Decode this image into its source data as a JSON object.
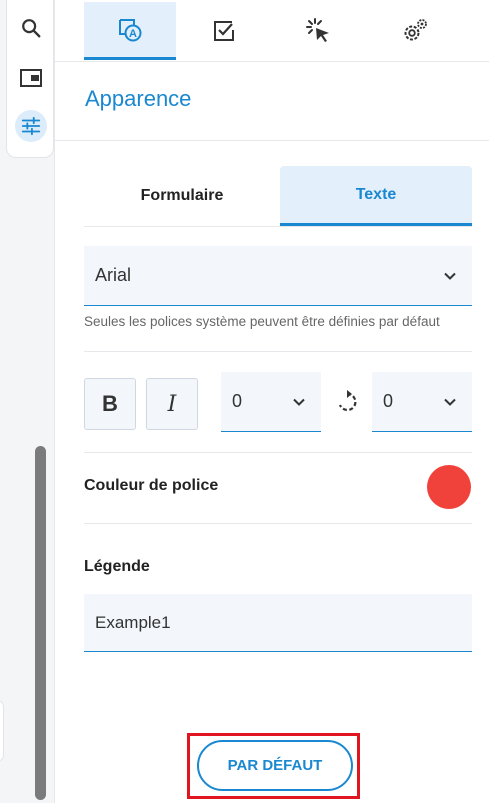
{
  "rail": {
    "icons": [
      "search-icon",
      "panel-icon",
      "sliders-icon"
    ],
    "active_index": 2
  },
  "top_tabs": {
    "icons": [
      "appearance-icon",
      "checkbox-icon",
      "click-icon",
      "settings-icon"
    ],
    "active_index": 0
  },
  "section": {
    "title": "Apparence"
  },
  "sub_tabs": {
    "items": [
      {
        "label": "Formulaire"
      },
      {
        "label": "Texte"
      }
    ],
    "active_index": 1
  },
  "font": {
    "value": "Arial",
    "hint": "Seules les polices système peuvent être définies par défaut"
  },
  "format": {
    "bold_label": "B",
    "italic_label": "I",
    "size_value": "0",
    "rotation_value": "0"
  },
  "color": {
    "label": "Couleur de police",
    "value": "#f0423b"
  },
  "legend": {
    "label": "Légende",
    "value": "Example1"
  },
  "actions": {
    "default_label": "PAR DÉFAUT"
  },
  "colors": {
    "accent": "#1a88d1",
    "highlight": "#e0151f"
  }
}
